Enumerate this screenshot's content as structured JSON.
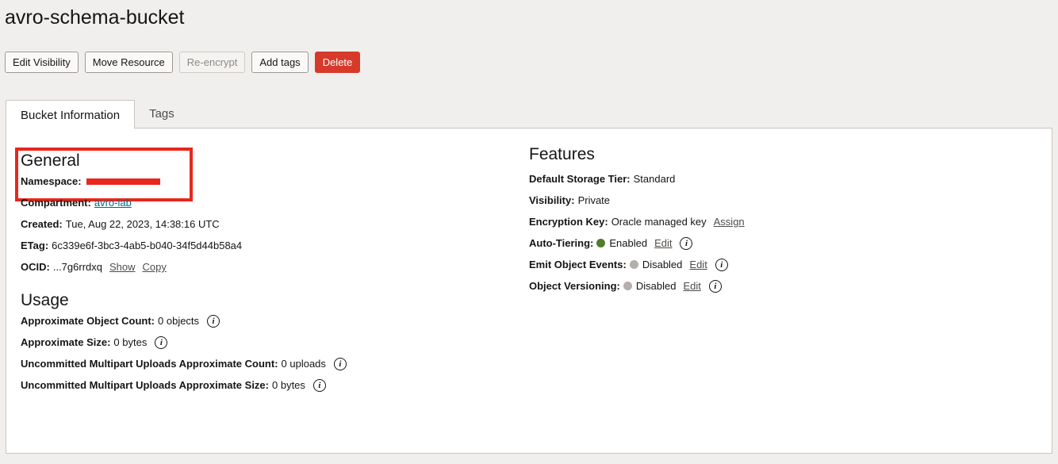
{
  "header": {
    "title": "avro-schema-bucket"
  },
  "actions": {
    "edit_visibility": "Edit Visibility",
    "move_resource": "Move Resource",
    "reencrypt": "Re-encrypt",
    "add_tags": "Add tags",
    "delete": "Delete"
  },
  "tabs": [
    {
      "label": "Bucket Information"
    },
    {
      "label": "Tags"
    }
  ],
  "general": {
    "heading": "General",
    "namespace_label": "Namespace:",
    "compartment_label": "Compartment:",
    "compartment_value": "avro-lab",
    "created_label": "Created:",
    "created_value": "Tue, Aug 22, 2023, 14:38:16 UTC",
    "etag_label": "ETag:",
    "etag_value": "6c339e6f-3bc3-4ab5-b040-34f5d44b58a4",
    "ocid_label": "OCID:",
    "ocid_value": "...7g6rrdxq",
    "show": "Show",
    "copy": "Copy"
  },
  "usage": {
    "heading": "Usage",
    "object_count_label": "Approximate Object Count:",
    "object_count_value": "0 objects",
    "size_label": "Approximate Size:",
    "size_value": "0 bytes",
    "mp_count_label": "Uncommitted Multipart Uploads Approximate Count:",
    "mp_count_value": "0 uploads",
    "mp_size_label": "Uncommitted Multipart Uploads Approximate Size:",
    "mp_size_value": "0 bytes"
  },
  "features": {
    "heading": "Features",
    "storage_tier_label": "Default Storage Tier:",
    "storage_tier_value": "Standard",
    "visibility_label": "Visibility:",
    "visibility_value": "Private",
    "encryption_label": "Encryption Key:",
    "encryption_value": "Oracle managed key",
    "assign": "Assign",
    "auto_tiering_label": "Auto-Tiering:",
    "auto_tiering_value": "Enabled",
    "events_label": "Emit Object Events:",
    "events_value": "Disabled",
    "versioning_label": "Object Versioning:",
    "versioning_value": "Disabled",
    "edit": "Edit"
  },
  "colors": {
    "enabled": "#4f7d2c",
    "disabled": "#b4afaa",
    "danger": "#d73a2b",
    "annotation": "#e8271c"
  },
  "icons": {
    "info": "info-icon"
  }
}
